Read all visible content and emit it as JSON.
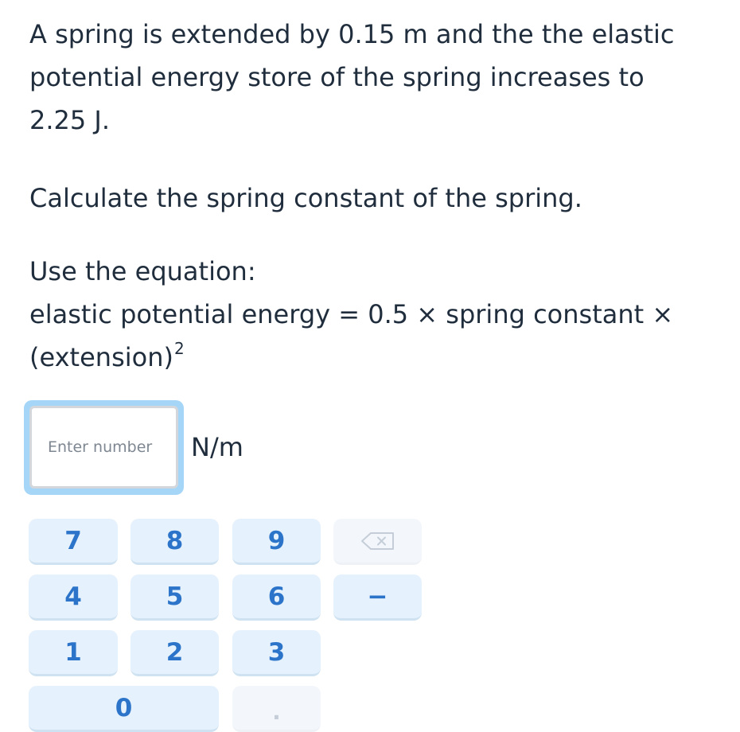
{
  "question": {
    "line1": "A spring is extended by 0.15 m and the the elastic",
    "line2": "potential energy store of the spring increases to",
    "line3": "2.25 J.",
    "calculate": "Calculate the spring constant of the spring.",
    "use_equation": "Use the equation:",
    "equation_line1": "elastic potential energy = 0.5 × spring constant ×",
    "equation_line2": "(extension)",
    "exponent": "2"
  },
  "answer": {
    "placeholder": "Enter number",
    "value": "",
    "unit": "N/m"
  },
  "keypad": {
    "keys": {
      "k7": "7",
      "k8": "8",
      "k9": "9",
      "k4": "4",
      "k5": "5",
      "k6": "6",
      "k1": "1",
      "k2": "2",
      "k3": "3",
      "k0": "0",
      "minus": "−",
      "decimal": "."
    },
    "backspace_icon": "backspace-icon",
    "colors": {
      "key_bg": "#e5f1fc",
      "key_text": "#2b74c9",
      "disabled_key_bg": "#f3f7fb",
      "input_focus_ring": "#a6d6f7"
    }
  }
}
